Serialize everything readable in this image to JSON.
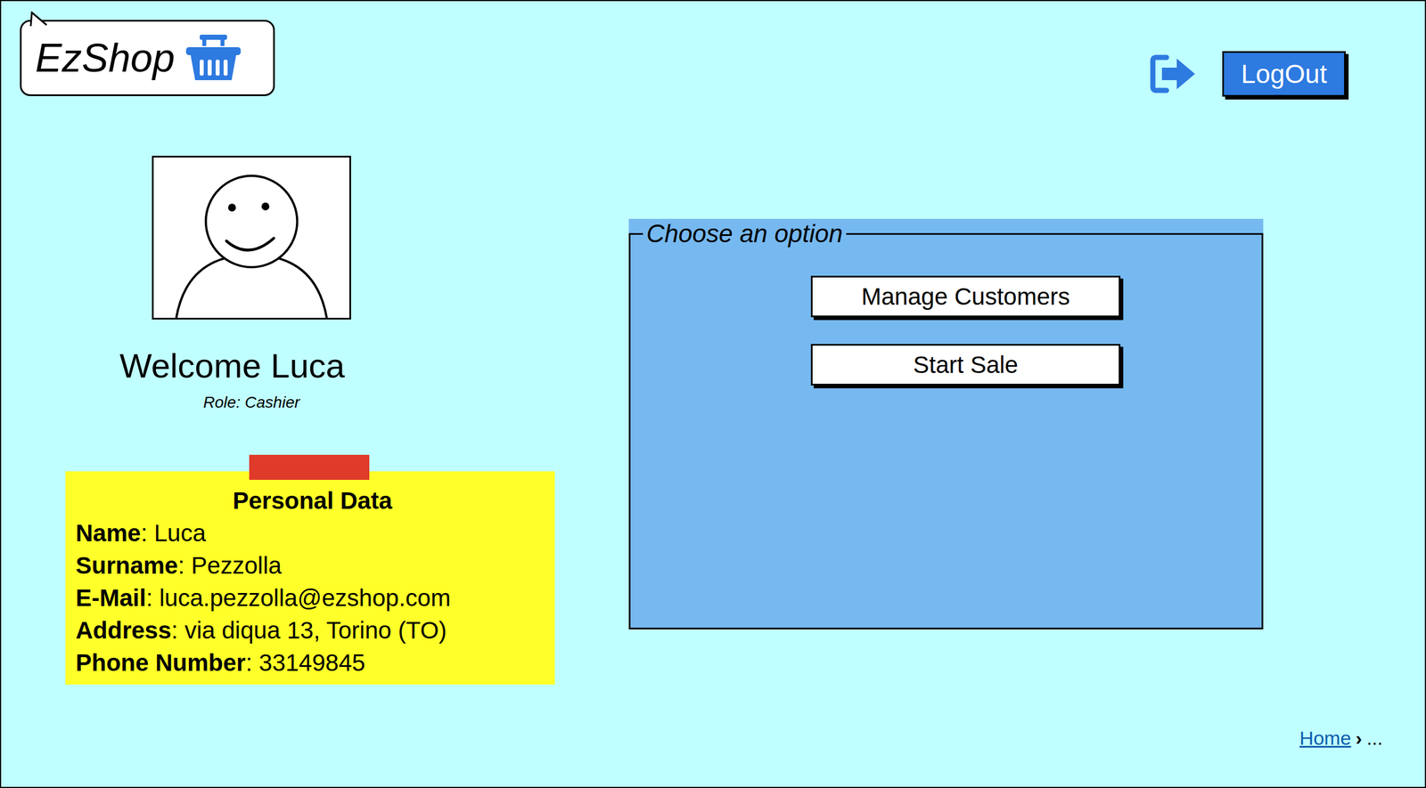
{
  "logo": {
    "text": "EzShop"
  },
  "header": {
    "logout_button": "LogOut"
  },
  "user": {
    "welcome": "Welcome Luca",
    "role": "Role: Cashier"
  },
  "personal_data": {
    "title": "Personal Data",
    "fields": [
      {
        "label": "Name",
        "value": ": Luca"
      },
      {
        "label": "Surname",
        "value": ": Pezzolla"
      },
      {
        "label": "E-Mail",
        "value": ": luca.pezzolla@ezshop.com"
      },
      {
        "label": "Address",
        "value": ": via diqua 13, Torino (TO)"
      },
      {
        "label": "Phone Number",
        "value": ": 33149845"
      }
    ]
  },
  "options": {
    "legend": "Choose an option",
    "buttons": [
      "Manage Customers",
      "Start Sale"
    ]
  },
  "breadcrumb": {
    "separator": "›",
    "items": [
      {
        "label": "Home",
        "kind": "link"
      },
      {
        "label": "...",
        "kind": "text"
      }
    ]
  }
}
